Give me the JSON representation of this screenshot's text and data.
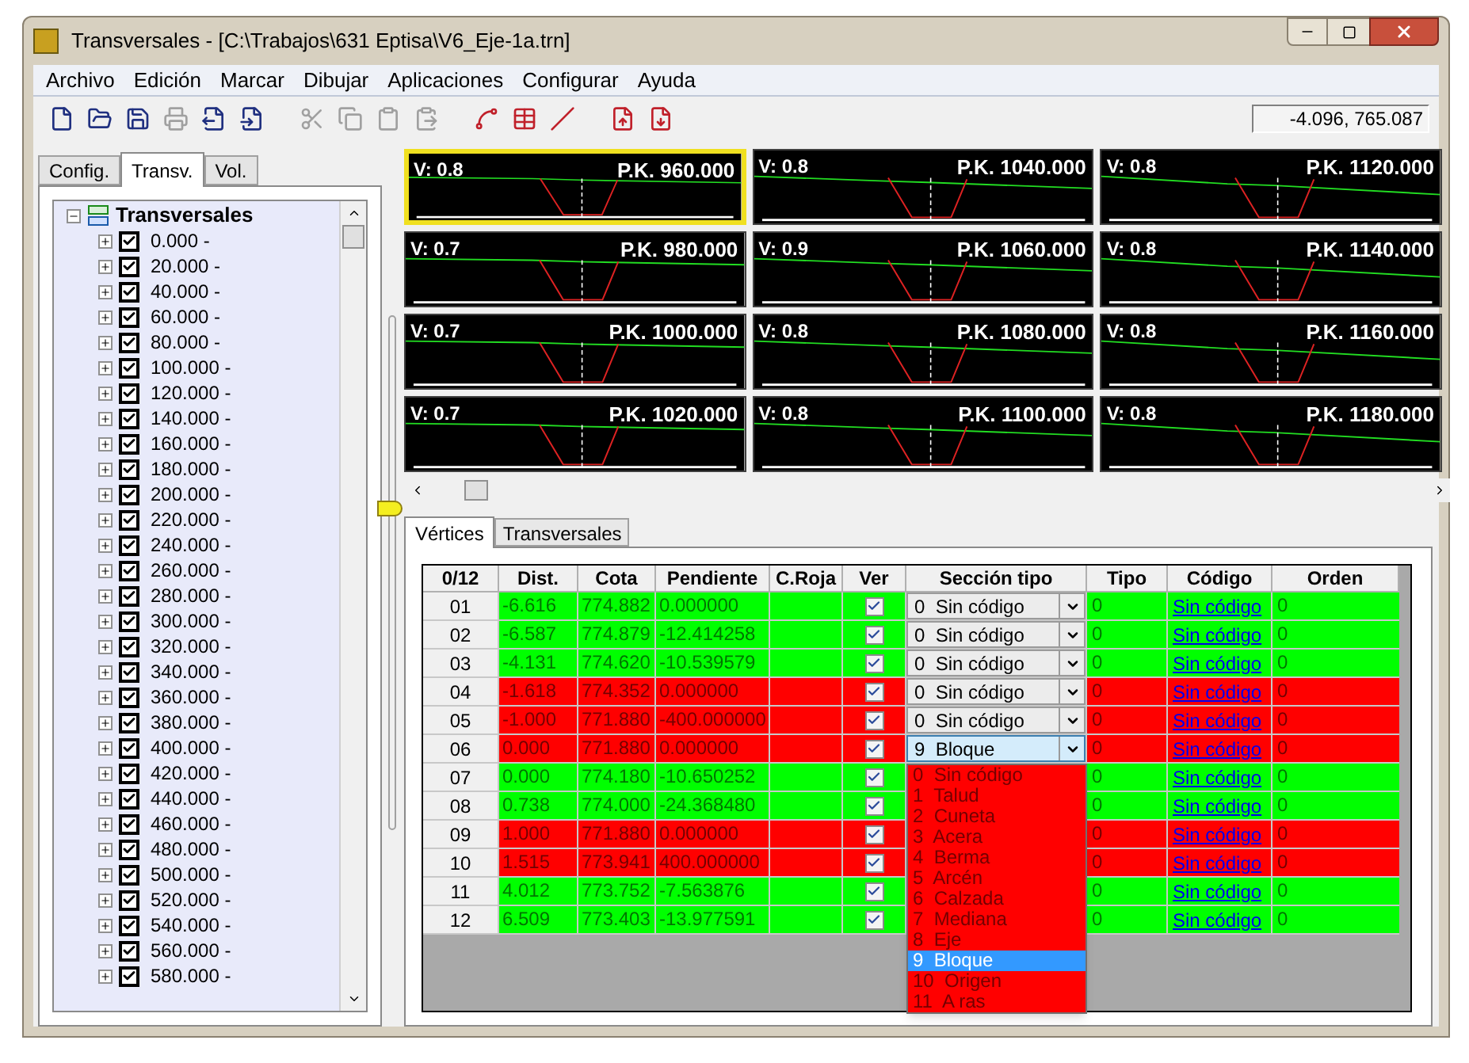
{
  "window": {
    "title": "Transversales - [C:\\Trabajos\\631 Eptisa\\V6_Eje-1a.trn]"
  },
  "menu": [
    "Archivo",
    "Edición",
    "Marcar",
    "Dibujar",
    "Aplicaciones",
    "Configurar",
    "Ayuda"
  ],
  "toolbar": [
    {
      "disabled": false
    },
    {
      "disabled": false
    },
    {
      "disabled": false
    },
    {
      "disabled": true
    },
    {
      "disabled": false
    },
    {
      "disabled": false
    },
    {
      "disabled": true
    },
    {
      "disabled": true
    },
    {
      "disabled": true
    },
    {
      "disabled": true
    },
    {
      "disabled": false
    },
    {
      "disabled": false
    },
    {
      "disabled": false
    },
    {
      "disabled": false
    },
    {
      "disabled": false
    }
  ],
  "coordinates": "-4.096, 765.087",
  "left_tabs": [
    {
      "label": "Config.",
      "selected": false
    },
    {
      "label": "Transv.",
      "selected": true
    },
    {
      "label": "Vol.",
      "selected": false
    }
  ],
  "tree": {
    "label": "Transversales",
    "expanded": true,
    "children": [
      {
        "label": "0.000 -",
        "checked": true
      },
      {
        "label": "20.000 -",
        "checked": true
      },
      {
        "label": "40.000 -",
        "checked": true
      },
      {
        "label": "60.000 -",
        "checked": true
      },
      {
        "label": "80.000 -",
        "checked": true
      },
      {
        "label": "100.000 -",
        "checked": true
      },
      {
        "label": "120.000 -",
        "checked": true
      },
      {
        "label": "140.000 -",
        "checked": true
      },
      {
        "label": "160.000 -",
        "checked": true
      },
      {
        "label": "180.000 -",
        "checked": true
      },
      {
        "label": "200.000 -",
        "checked": true
      },
      {
        "label": "220.000 -",
        "checked": true
      },
      {
        "label": "240.000 -",
        "checked": true
      },
      {
        "label": "260.000 -",
        "checked": true
      },
      {
        "label": "280.000 -",
        "checked": true
      },
      {
        "label": "300.000 -",
        "checked": true
      },
      {
        "label": "320.000 -",
        "checked": true
      },
      {
        "label": "340.000 -",
        "checked": true
      },
      {
        "label": "360.000 -",
        "checked": true
      },
      {
        "label": "380.000 -",
        "checked": true
      },
      {
        "label": "400.000 -",
        "checked": true
      },
      {
        "label": "420.000 -",
        "checked": true
      },
      {
        "label": "440.000 -",
        "checked": true
      },
      {
        "label": "460.000 -",
        "checked": true
      },
      {
        "label": "480.000 -",
        "checked": true
      },
      {
        "label": "500.000 -",
        "checked": true
      },
      {
        "label": "520.000 -",
        "checked": true
      },
      {
        "label": "540.000 -",
        "checked": true
      },
      {
        "label": "560.000 -",
        "checked": true
      },
      {
        "label": "580.000 -",
        "checked": true
      }
    ]
  },
  "sections": [
    {
      "v": "V: 0.8",
      "pk": "P.K. 960.000",
      "selected": true
    },
    {
      "v": "V: 0.8",
      "pk": "P.K. 1040.000",
      "selected": false
    },
    {
      "v": "V: 0.8",
      "pk": "P.K. 1120.000",
      "selected": false
    },
    {
      "v": "V: 0.7",
      "pk": "P.K. 980.000",
      "selected": false
    },
    {
      "v": "V: 0.9",
      "pk": "P.K. 1060.000",
      "selected": false
    },
    {
      "v": "V: 0.8",
      "pk": "P.K. 1140.000",
      "selected": false
    },
    {
      "v": "V: 0.7",
      "pk": "P.K. 1000.000",
      "selected": false
    },
    {
      "v": "V: 0.8",
      "pk": "P.K. 1080.000",
      "selected": false
    },
    {
      "v": "V: 0.8",
      "pk": "P.K. 1160.000",
      "selected": false
    },
    {
      "v": "V: 0.7",
      "pk": "P.K. 1020.000",
      "selected": false
    },
    {
      "v": "V: 0.8",
      "pk": "P.K. 1100.000",
      "selected": false
    },
    {
      "v": "V: 0.8",
      "pk": "P.K. 1180.000",
      "selected": false
    }
  ],
  "table_tabs": [
    {
      "label": "Vértices",
      "selected": true
    },
    {
      "label": "Transversales",
      "selected": false
    }
  ],
  "table": {
    "columns": [
      "0/12",
      "Dist.",
      "Cota",
      "Pendiente",
      "C.Roja",
      "Ver",
      "Sección tipo",
      "Tipo",
      "Código",
      "Orden"
    ],
    "rows": [
      {
        "id": "01",
        "dist": "-6.616",
        "cota": "774.882",
        "pendiente": "0.000000",
        "ver": true,
        "seccion": "0  Sin código",
        "tipo": "0",
        "codigo": "Sin código",
        "orden": "0",
        "color": "#00ff00",
        "open": false
      },
      {
        "id": "02",
        "dist": "-6.587",
        "cota": "774.879",
        "pendiente": "-12.414258",
        "ver": true,
        "seccion": "0  Sin código",
        "tipo": "0",
        "codigo": "Sin código",
        "orden": "0",
        "color": "#00ff00",
        "open": false
      },
      {
        "id": "03",
        "dist": "-4.131",
        "cota": "774.620",
        "pendiente": "-10.539579",
        "ver": true,
        "seccion": "0  Sin código",
        "tipo": "0",
        "codigo": "Sin código",
        "orden": "0",
        "color": "#00ff00",
        "open": false
      },
      {
        "id": "04",
        "dist": "-1.618",
        "cota": "774.352",
        "pendiente": "0.000000",
        "ver": true,
        "seccion": "0  Sin código",
        "tipo": "0",
        "codigo": "Sin código",
        "orden": "0",
        "color": "#ff0000",
        "open": false
      },
      {
        "id": "05",
        "dist": "-1.000",
        "cota": "771.880",
        "pendiente": "-400.000000",
        "ver": true,
        "seccion": "0  Sin código",
        "tipo": "0",
        "codigo": "Sin código",
        "orden": "0",
        "color": "#ff0000",
        "open": false
      },
      {
        "id": "06",
        "dist": "0.000",
        "cota": "771.880",
        "pendiente": "0.000000",
        "ver": true,
        "seccion": "9  Bloque",
        "tipo": "0",
        "codigo": "Sin código",
        "orden": "0",
        "color": "#ff0000",
        "open": true
      },
      {
        "id": "07",
        "dist": "0.000",
        "cota": "774.180",
        "pendiente": "-10.650252",
        "ver": true,
        "tipo": "0",
        "codigo": "Sin código",
        "orden": "0",
        "color": "#00ff00"
      },
      {
        "id": "08",
        "dist": "0.738",
        "cota": "774.000",
        "pendiente": "-24.368480",
        "ver": true,
        "tipo": "0",
        "codigo": "Sin código",
        "orden": "0",
        "color": "#00ff00"
      },
      {
        "id": "09",
        "dist": "1.000",
        "cota": "771.880",
        "pendiente": "0.000000",
        "ver": true,
        "tipo": "0",
        "codigo": "Sin código",
        "orden": "0",
        "color": "#ff0000"
      },
      {
        "id": "10",
        "dist": "1.515",
        "cota": "773.941",
        "pendiente": "400.000000",
        "ver": true,
        "tipo": "0",
        "codigo": "Sin código",
        "orden": "0",
        "color": "#ff0000"
      },
      {
        "id": "11",
        "dist": "4.012",
        "cota": "773.752",
        "pendiente": "-7.563876",
        "ver": true,
        "tipo": "0",
        "codigo": "Sin código",
        "orden": "0",
        "color": "#00ff00"
      },
      {
        "id": "12",
        "dist": "6.509",
        "cota": "773.403",
        "pendiente": "-13.977591",
        "ver": true,
        "tipo": "0",
        "codigo": "Sin código",
        "orden": "0",
        "color": "#00ff00"
      }
    ]
  },
  "dropdown_options": [
    {
      "label": "0  Sin código",
      "selected": false
    },
    {
      "label": "1  Talud",
      "selected": false
    },
    {
      "label": "2  Cuneta",
      "selected": false
    },
    {
      "label": "3  Acera",
      "selected": false
    },
    {
      "label": "4  Berma",
      "selected": false
    },
    {
      "label": "5  Arcén",
      "selected": false
    },
    {
      "label": "6  Calzada",
      "selected": false
    },
    {
      "label": "7  Mediana",
      "selected": false
    },
    {
      "label": "8  Eje",
      "selected": false
    },
    {
      "label": "9  Bloque",
      "selected": true
    },
    {
      "label": "10  Origen",
      "selected": false
    },
    {
      "label": "11  A ras",
      "selected": false
    }
  ]
}
